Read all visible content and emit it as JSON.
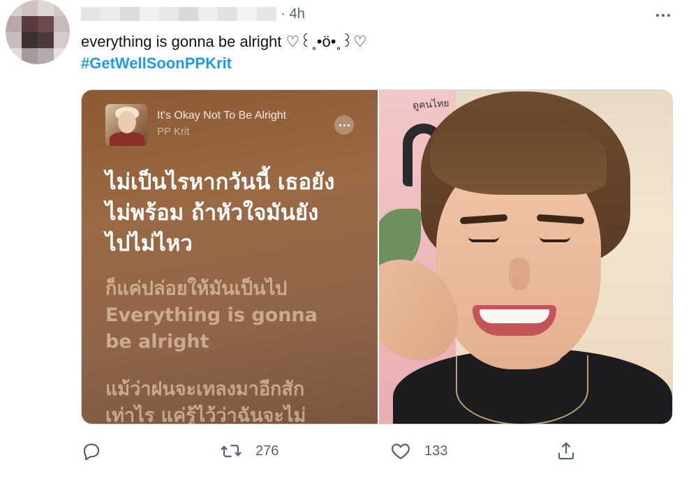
{
  "tweet": {
    "time": "4h",
    "separator": "·",
    "text": "everything is gonna be alright ♡꒰˳•ö•˳꒱♡",
    "hashtag": "#GetWellSoonPPKrit"
  },
  "media": {
    "song": {
      "title": "It's Okay Not To Be Alright",
      "artist": "PP Krit"
    },
    "lyrics_current": [
      "ไม่เป็นไรหากวันนี้ เธอยัง",
      "ไม่พร้อม ถ้าหัวใจมันยัง",
      "ไปไม่ไหว"
    ],
    "lyrics_following": [
      "ก็แค่ปล่อยให้มันเป็นไป",
      "Everything is gonna",
      "be alright"
    ],
    "lyrics_next": [
      "แม้ว่าฝนจะเทลงมาอีกสัก",
      "เท่าไร แค่รู้ไว้ว่าฉันจะไม่"
    ],
    "poster_text": "ดูคนไทย"
  },
  "actions": {
    "reply_icon": "reply-icon",
    "retweet_icon": "retweet-icon",
    "retweet_count": "276",
    "like_icon": "heart-icon",
    "like_count": "133",
    "share_icon": "share-icon"
  },
  "colors": {
    "link": "#1d9bf0",
    "secondary_text": "#536471",
    "primary_text": "#0f1419"
  }
}
